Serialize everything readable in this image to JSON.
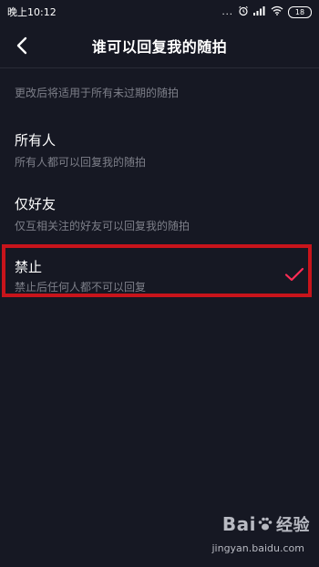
{
  "status_bar": {
    "time": "晚上10:12",
    "dots": "...",
    "battery": "18"
  },
  "nav": {
    "title": "谁可以回复我的随拍"
  },
  "hint": "更改后将适用于所有未过期的随拍",
  "options": [
    {
      "title": "所有人",
      "desc": "所有人都可以回复我的随拍",
      "selected": false
    },
    {
      "title": "仅好友",
      "desc": "仅互相关注的好友可以回复我的随拍",
      "selected": false
    },
    {
      "title": "禁止",
      "desc": "禁止后任何人都不可以回复",
      "selected": true
    }
  ],
  "watermark": {
    "logo_a": "Bai",
    "logo_b": "经验",
    "url": "jingyan.baidu.com"
  },
  "colors": {
    "background": "#161823",
    "accent_check": "#fe2c55",
    "highlight_border": "#c8141b"
  },
  "icons": {
    "back": "back-arrow-icon",
    "check": "checkmark-icon",
    "alarm": "alarm-icon",
    "signal": "signal-icon",
    "wifi": "wifi-icon"
  }
}
